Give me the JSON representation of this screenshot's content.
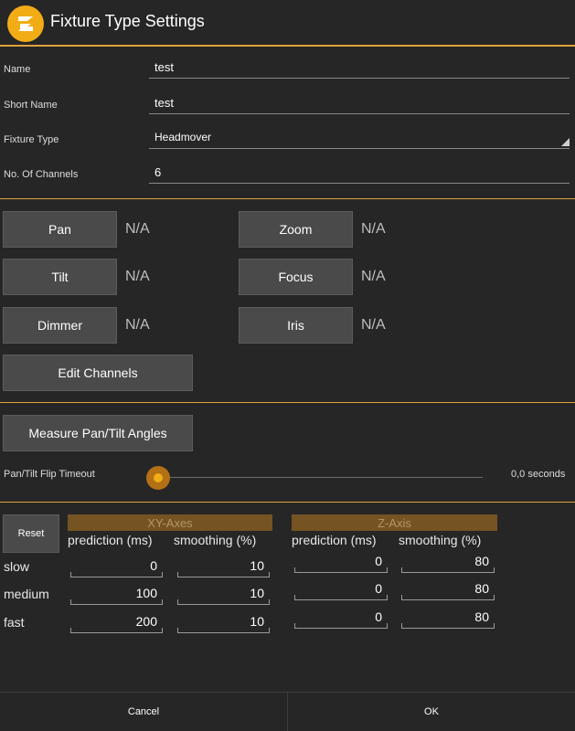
{
  "window": {
    "title": "Fixture Type Settings"
  },
  "form": {
    "name_label": "Name",
    "name_value": "test",
    "short_name_label": "Short Name",
    "short_name_value": "test",
    "fixture_type_label": "Fixture Type",
    "fixture_type_value": "Headmover",
    "channels_label": "No. Of Channels",
    "channels_value": "6"
  },
  "channels": {
    "pan_label": "Pan",
    "pan_value": "N/A",
    "tilt_label": "Tilt",
    "tilt_value": "N/A",
    "dimmer_label": "Dimmer",
    "dimmer_value": "N/A",
    "zoom_label": "Zoom",
    "zoom_value": "N/A",
    "focus_label": "Focus",
    "focus_value": "N/A",
    "iris_label": "Iris",
    "iris_value": "N/A",
    "edit_label": "Edit Channels"
  },
  "angles": {
    "measure_label": "Measure Pan/Tilt Angles",
    "flip_timeout_label": "Pan/Tilt Flip Timeout",
    "flip_timeout_value": "0,0 seconds",
    "flip_timeout_fraction": 0
  },
  "smoothing": {
    "reset_label": "Reset",
    "xy_header": "XY-Axes",
    "z_header": "Z-Axis",
    "prediction_header": "prediction (ms)",
    "smoothing_header": "smoothing (%)",
    "rows": [
      {
        "label": "slow",
        "xy_prediction": "0",
        "xy_smoothing": "10",
        "z_prediction": "0",
        "z_smoothing": "80"
      },
      {
        "label": "medium",
        "xy_prediction": "100",
        "xy_smoothing": "10",
        "z_prediction": "0",
        "z_smoothing": "80"
      },
      {
        "label": "fast",
        "xy_prediction": "200",
        "xy_smoothing": "10",
        "z_prediction": "0",
        "z_smoothing": "80"
      }
    ]
  },
  "footer": {
    "cancel_label": "Cancel",
    "ok_label": "OK"
  },
  "colors": {
    "accent": "#f2ac16",
    "divider": "#e2a23a",
    "header_bg": "#765322",
    "background": "#262626"
  }
}
